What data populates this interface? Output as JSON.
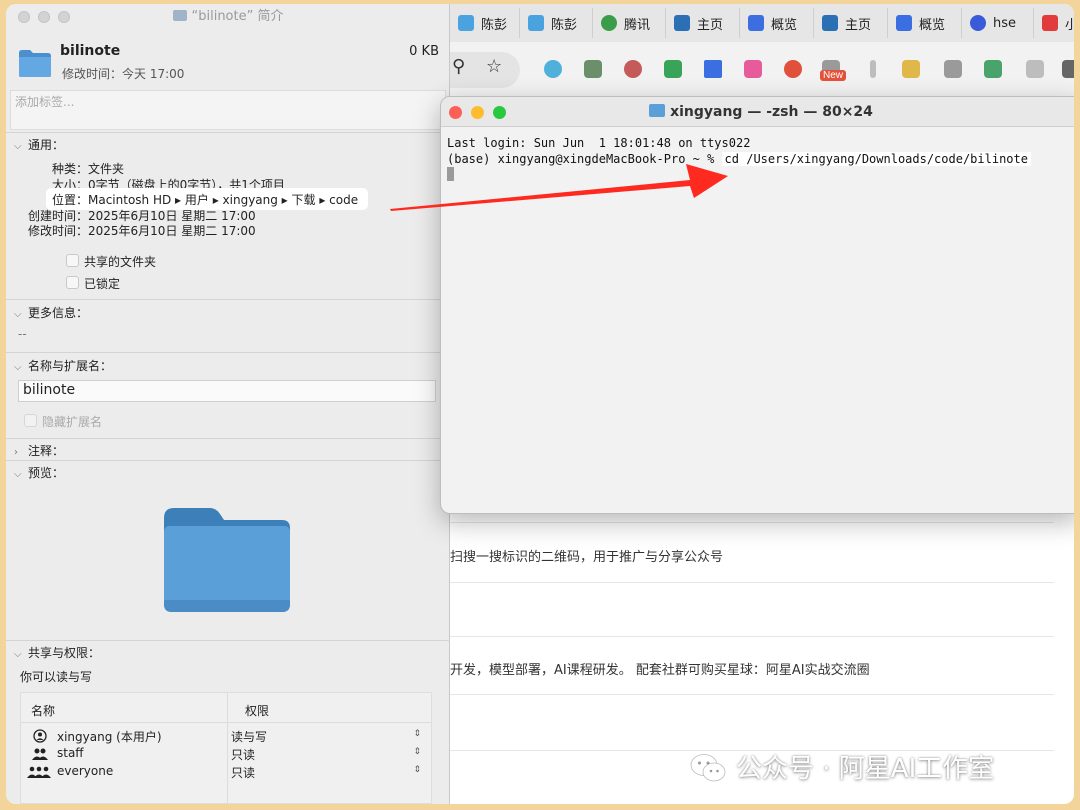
{
  "colors": {
    "folder_blue": "#5b9fd8",
    "highlight": "#ffffff",
    "arrow_red": "#ff2a1f",
    "tl_red": "#fe5f57",
    "tl_yellow": "#febc2e",
    "tl_green": "#28c840"
  },
  "browser": {
    "tabs": [
      {
        "label": "陈彭",
        "icon": "bilibili-icon",
        "color": "#4aa3df"
      },
      {
        "label": "陈彭",
        "icon": "bilibili-icon",
        "color": "#4aa3df"
      },
      {
        "label": "腾讯",
        "icon": "tencent-icon",
        "color": "#3a9d4a"
      },
      {
        "label": "主页",
        "icon": "app-icon",
        "color": "#2b6fb5"
      },
      {
        "label": "概览",
        "icon": "doc-icon",
        "color": "#3b6ee0"
      },
      {
        "label": "主页",
        "icon": "app-icon",
        "color": "#2b6fb5"
      },
      {
        "label": "概览",
        "icon": "doc-icon",
        "color": "#3b6ee0"
      },
      {
        "label": "hse",
        "icon": "baidu-icon",
        "color": "#3a5bd9"
      },
      {
        "label": "小",
        "icon": "xiaohongshu-icon",
        "color": "#e23b3b"
      }
    ],
    "new_badge": "New",
    "content": {
      "line1": "扫搜一搜标识的二维码，用于推广与分享公众号",
      "line2": "开发，模型部署，AI课程研发。 配套社群可购买星球：阿星AI实战交流圈"
    }
  },
  "info": {
    "window_title": "“bilinote” 简介",
    "name": "bilinote",
    "size": "0 KB",
    "modified": "修改时间：今天 17:00",
    "tags_placeholder": "添加标签...",
    "general": {
      "header": "通用：",
      "kind": "种类：文件夹",
      "size": "大小：0字节（磁盘上的0字节），共1个项目",
      "where": "位置：Macintosh HD ▸ 用户 ▸ xingyang ▸ 下载 ▸ code",
      "created": "创建时间：2025年6月10日 星期二 17:00",
      "modified": "修改时间：2025年6月10日 星期二 17:00",
      "shared_folder": "共享的文件夹",
      "locked": "已锁定"
    },
    "more_info": {
      "header": "更多信息：",
      "value": "--"
    },
    "name_ext": {
      "header": "名称与扩展名：",
      "value": "bilinote",
      "hide_ext": "隐藏扩展名"
    },
    "comments": {
      "header": "注释："
    },
    "preview": {
      "header": "预览："
    },
    "sharing": {
      "header": "共享与权限：",
      "summary": "你可以读与写",
      "col_name": "名称",
      "col_priv": "权限",
      "rows": [
        {
          "name": "xingyang (本用户)",
          "priv": "读与写",
          "icon": "user-circle-icon"
        },
        {
          "name": "staff",
          "priv": "只读",
          "icon": "group-icon"
        },
        {
          "name": "everyone",
          "priv": "只读",
          "icon": "everyone-icon"
        }
      ]
    }
  },
  "terminal": {
    "title": "xingyang — -zsh — 80×24",
    "line1": "Last login: Sun Jun  1 18:01:48 on ttys022",
    "prompt": "(base) xingyang@xingdeMacBook-Pro ~ % ",
    "command": "cd /Users/xingyang/Downloads/code/bilinote"
  },
  "watermark": {
    "text": "公众号 · 阿星AI工作室"
  }
}
